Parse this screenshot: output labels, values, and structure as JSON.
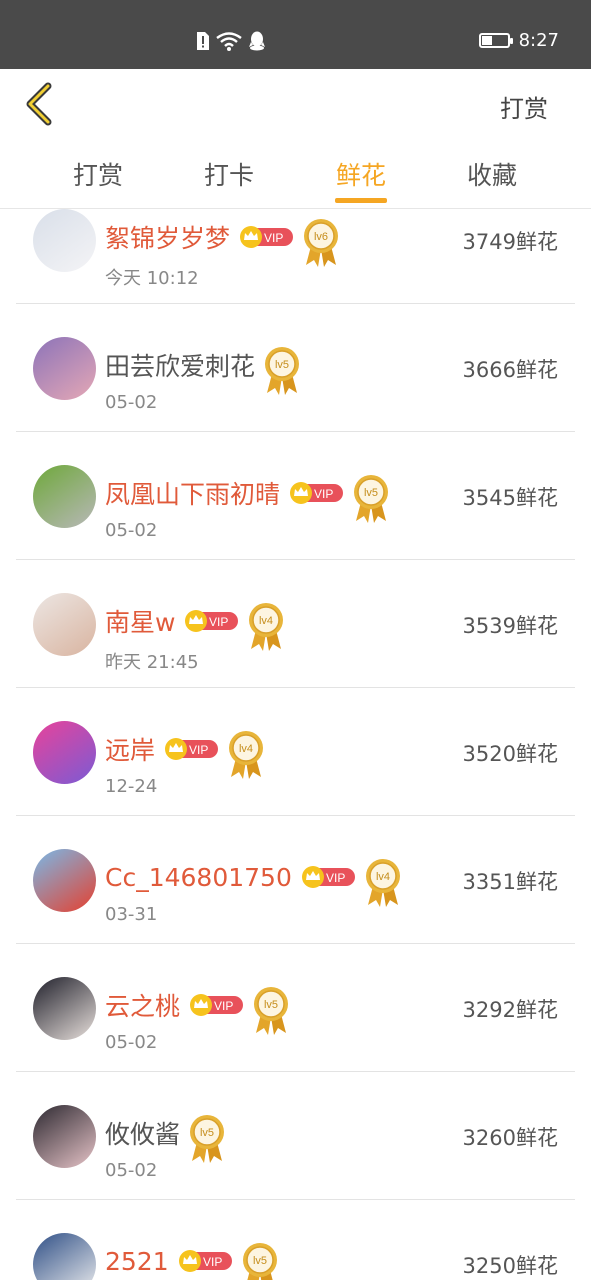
{
  "status_bar": {
    "time": "8:27",
    "battery_level": 0.4
  },
  "header": {
    "back_icon": "chevron-left-icon",
    "action_label": "打赏"
  },
  "tabs": [
    {
      "label": "打赏",
      "active": false
    },
    {
      "label": "打卡",
      "active": false
    },
    {
      "label": "鲜花",
      "active": true
    },
    {
      "label": "收藏",
      "active": false
    }
  ],
  "colors": {
    "accent": "#f5a623",
    "vip_name": "#e05a3a",
    "vip_badge": "#e8515a",
    "crown": "#f6c31d"
  },
  "list": [
    {
      "name": "絮锦岁岁梦",
      "vip": true,
      "level": "lv6",
      "date": "今天 10:12",
      "flowers": "3749鲜花",
      "avatar_colors": [
        "#d9dfe9",
        "#f4f4f6"
      ]
    },
    {
      "name": "田芸欣爱刺花",
      "vip": false,
      "level": "lv5",
      "date": "05-02",
      "flowers": "3666鲜花",
      "avatar_colors": [
        "#8c73b8",
        "#e5a8b6"
      ]
    },
    {
      "name": "凤凰山下雨初晴",
      "vip": true,
      "level": "lv5",
      "date": "05-02",
      "flowers": "3545鲜花",
      "avatar_colors": [
        "#6ea83a",
        "#b8b8b8"
      ]
    },
    {
      "name": "南星w",
      "vip": true,
      "level": "lv4",
      "date": "昨天 21:45",
      "flowers": "3539鲜花",
      "avatar_colors": [
        "#ece6e3",
        "#d9b4a0"
      ]
    },
    {
      "name": "远岸",
      "vip": true,
      "level": "lv4",
      "date": "12-24",
      "flowers": "3520鲜花",
      "avatar_colors": [
        "#e8439a",
        "#7b5bd4"
      ]
    },
    {
      "name": "Cc_146801750",
      "vip": true,
      "level": "lv4",
      "date": "03-31",
      "flowers": "3351鲜花",
      "avatar_colors": [
        "#79b9e8",
        "#e5402f"
      ]
    },
    {
      "name": "云之桃",
      "vip": true,
      "level": "lv5",
      "date": "05-02",
      "flowers": "3292鲜花",
      "avatar_colors": [
        "#1f1f2a",
        "#e8e0dc"
      ]
    },
    {
      "name": "攸攸酱",
      "vip": false,
      "level": "lv5",
      "date": "05-02",
      "flowers": "3260鲜花",
      "avatar_colors": [
        "#2c2830",
        "#e7c4c8"
      ]
    },
    {
      "name": "2521",
      "vip": true,
      "level": "lv5",
      "date": "",
      "flowers": "3250鲜花",
      "avatar_colors": [
        "#2f4f86",
        "#f0f0f0"
      ]
    }
  ]
}
